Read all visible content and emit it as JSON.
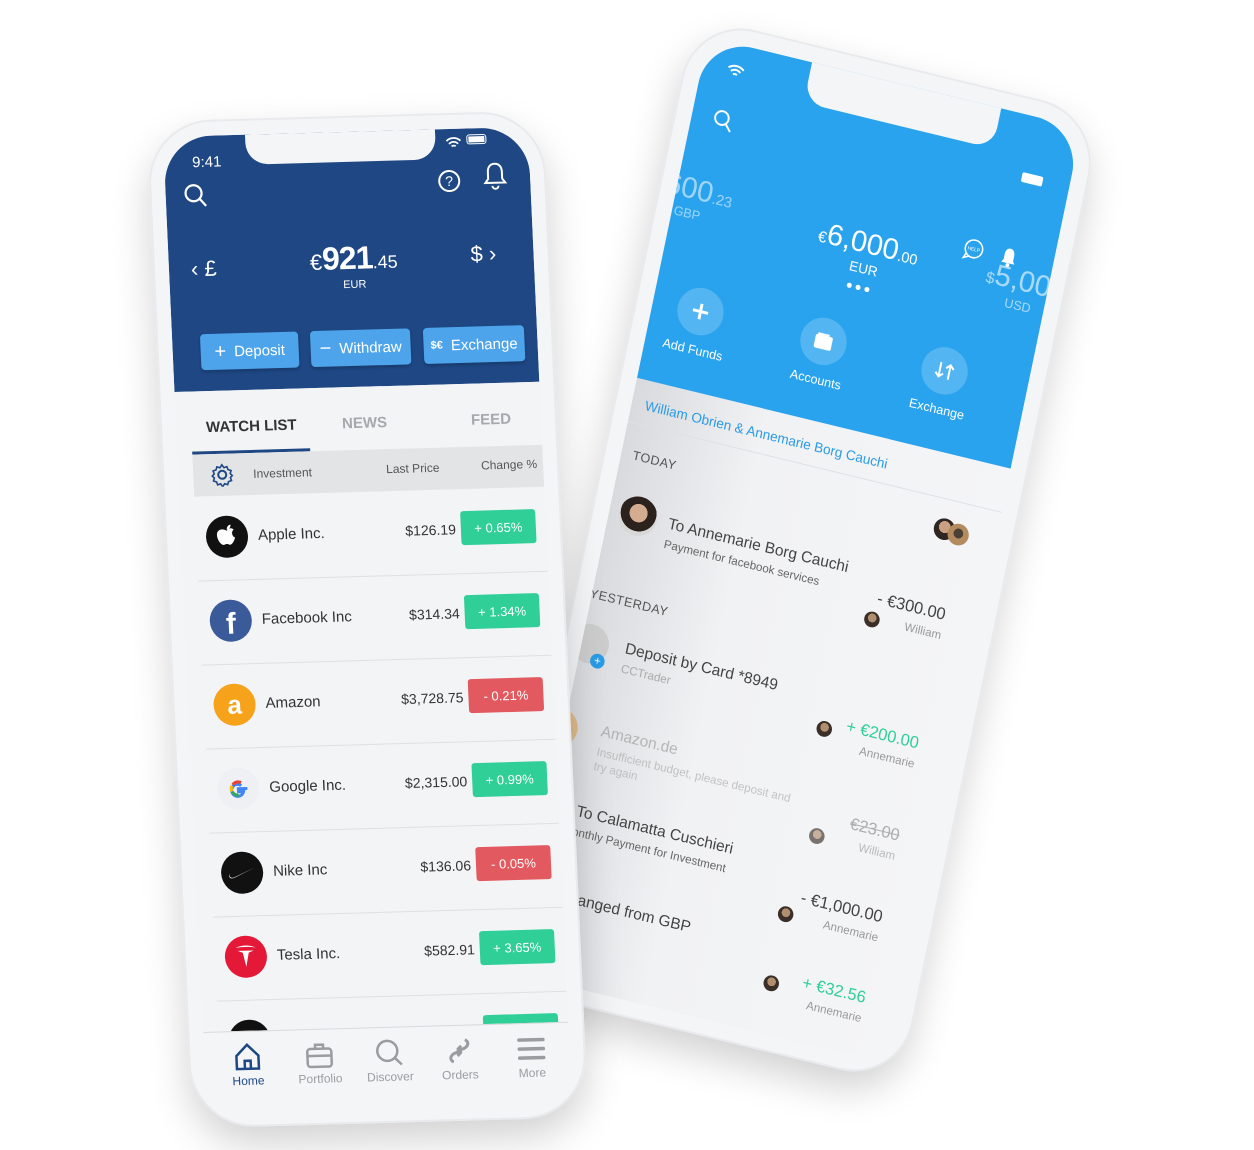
{
  "colors": {
    "left_header": "#1e4784",
    "action_button": "#4ea4ea",
    "positive": "#2fcf97",
    "negative": "#e25a5f",
    "right_header": "#29a3ee",
    "link_blue": "#2a9be6"
  },
  "left_phone": {
    "status": {
      "time": "9:41",
      "icons": [
        "wifi-icon",
        "battery-icon"
      ]
    },
    "header_icons": [
      "search-icon",
      "help-icon",
      "bell-icon"
    ],
    "balance": {
      "prev_currency": "£",
      "currency_symbol": "€",
      "amount_int": "921",
      "amount_dec": ".45",
      "currency_code": "EUR",
      "next_currency": "$"
    },
    "actions": [
      {
        "label": "Deposit",
        "icon": "plus-icon"
      },
      {
        "label": "Withdraw",
        "icon": "minus-icon"
      },
      {
        "label": "Exchange",
        "icon": "currency-exchange-icon"
      }
    ],
    "tabs": [
      {
        "label": "WATCH LIST",
        "active": true
      },
      {
        "label": "NEWS",
        "active": false
      },
      {
        "label": "FEED",
        "active": false
      }
    ],
    "table_header": {
      "investment": "Investment",
      "last_price": "Last Price",
      "change": "Change %"
    },
    "watchlist": [
      {
        "name": "Apple Inc.",
        "price": "$126.19",
        "change": "+ 0.65%",
        "direction": "up",
        "logo": "apple-logo"
      },
      {
        "name": "Facebook Inc",
        "price": "$314.34",
        "change": "+ 1.34%",
        "direction": "up",
        "logo": "facebook-logo"
      },
      {
        "name": "Amazon",
        "price": "$3,728.75",
        "change": "- 0.21%",
        "direction": "down",
        "logo": "amazon-logo"
      },
      {
        "name": "Google Inc.",
        "price": "$2,315.00",
        "change": "+ 0.99%",
        "direction": "up",
        "logo": "google-logo"
      },
      {
        "name": "Nike Inc",
        "price": "$136.06",
        "change": "- 0.05%",
        "direction": "down",
        "logo": "nike-logo"
      },
      {
        "name": "Tesla Inc.",
        "price": "$582.91",
        "change": "+ 3.65%",
        "direction": "up",
        "logo": "tesla-logo"
      },
      {
        "logo": "netflix-logo",
        "direction": "up"
      }
    ],
    "nav": [
      {
        "label": "Home",
        "icon": "home-icon",
        "active": true
      },
      {
        "label": "Portfolio",
        "icon": "briefcase-icon",
        "active": false
      },
      {
        "label": "Discover",
        "icon": "search-icon",
        "active": false
      },
      {
        "label": "Orders",
        "icon": "orders-icon",
        "active": false
      },
      {
        "label": "More",
        "icon": "menu-icon",
        "active": false
      }
    ]
  },
  "right_phone": {
    "status_icons": [
      "wifi-icon",
      "battery-icon"
    ],
    "header_icons": [
      "search-icon",
      "help-chat-icon",
      "bell-icon"
    ],
    "accounts": [
      {
        "amount": "600",
        "decimals": ".23",
        "currency": "GBP"
      },
      {
        "symbol": "€",
        "amount": "6,000",
        "decimals": ".00",
        "currency": "EUR"
      },
      {
        "symbol": "$",
        "amount": "5,00",
        "currency": "USD"
      }
    ],
    "actions": [
      {
        "label": "Add Funds",
        "icon": "plus-icon"
      },
      {
        "label": "Accounts",
        "icon": "wallet-icon"
      },
      {
        "label": "Exchange",
        "icon": "swap-arrows-icon"
      }
    ],
    "account_holders": "William Obrien & Annemarie Borg Cauchi",
    "sections": {
      "today": "TODAY",
      "yesterday": "YESTERDAY"
    },
    "transactions": [
      {
        "title": "To Annemarie Borg Cauchi",
        "subtitle": "Payment for facebook services",
        "amount": "- €300.00",
        "by": "William",
        "status": "debit"
      },
      {
        "title": "Deposit by Card *8949",
        "subtitle": "CCTrader",
        "amount": "+ €200.00",
        "by": "Annemarie",
        "status": "credit"
      },
      {
        "title": "Amazon.de",
        "subtitle": "Insufficient budget, please deposit and",
        "subtitle2": "try again",
        "amount": "€23.00",
        "by": "William",
        "status": "failed"
      },
      {
        "title": "To Calamatta Cuschieri",
        "subtitle": "onthly Payment for Investment",
        "amount": "- €1,000.00",
        "by": "Annemarie",
        "status": "debit"
      },
      {
        "title": "anged from GBP",
        "amount": "+ €32.56",
        "by": "Annemarie",
        "status": "credit"
      }
    ]
  }
}
